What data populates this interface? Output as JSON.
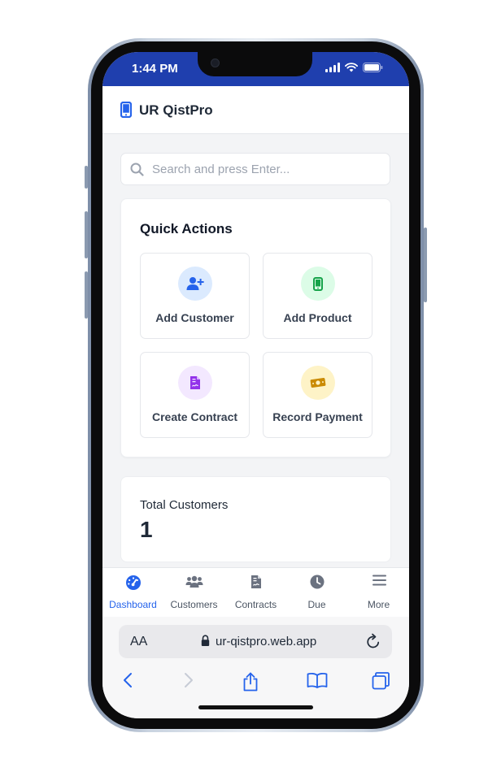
{
  "status_bar": {
    "time": "1:44 PM",
    "bar_color": "#1f3fae"
  },
  "app": {
    "title": "UR QistPro",
    "logo_icon": "mobile-phone-icon",
    "accent": "#2563eb"
  },
  "search": {
    "value": "",
    "placeholder": "Search and press Enter..."
  },
  "quick_actions": {
    "title": "Quick Actions",
    "items": [
      {
        "label": "Add Customer",
        "icon": "user-plus-icon",
        "bg": "#dbeafe",
        "fg": "#2563eb"
      },
      {
        "label": "Add Product",
        "icon": "mobile-phone-icon",
        "bg": "#dcfce7",
        "fg": "#16a34a"
      },
      {
        "label": "Create Contract",
        "icon": "contract-document-icon",
        "bg": "#f3e8ff",
        "fg": "#9333ea"
      },
      {
        "label": "Record Payment",
        "icon": "money-bill-icon",
        "bg": "#fef3c7",
        "fg": "#ca8a04"
      }
    ]
  },
  "stats": {
    "total_customers_label": "Total Customers",
    "total_customers_value": "1"
  },
  "bottom_nav": {
    "items": [
      {
        "label": "Dashboard",
        "icon": "gauge-icon",
        "active": true
      },
      {
        "label": "Customers",
        "icon": "users-icon",
        "active": false
      },
      {
        "label": "Contracts",
        "icon": "contract-document-icon",
        "active": false
      },
      {
        "label": "Due",
        "icon": "clock-icon",
        "active": false
      },
      {
        "label": "More",
        "icon": "menu-icon",
        "active": false
      }
    ]
  },
  "browser": {
    "text_size_label": "AA",
    "url": "ur-qistpro.web.app"
  }
}
